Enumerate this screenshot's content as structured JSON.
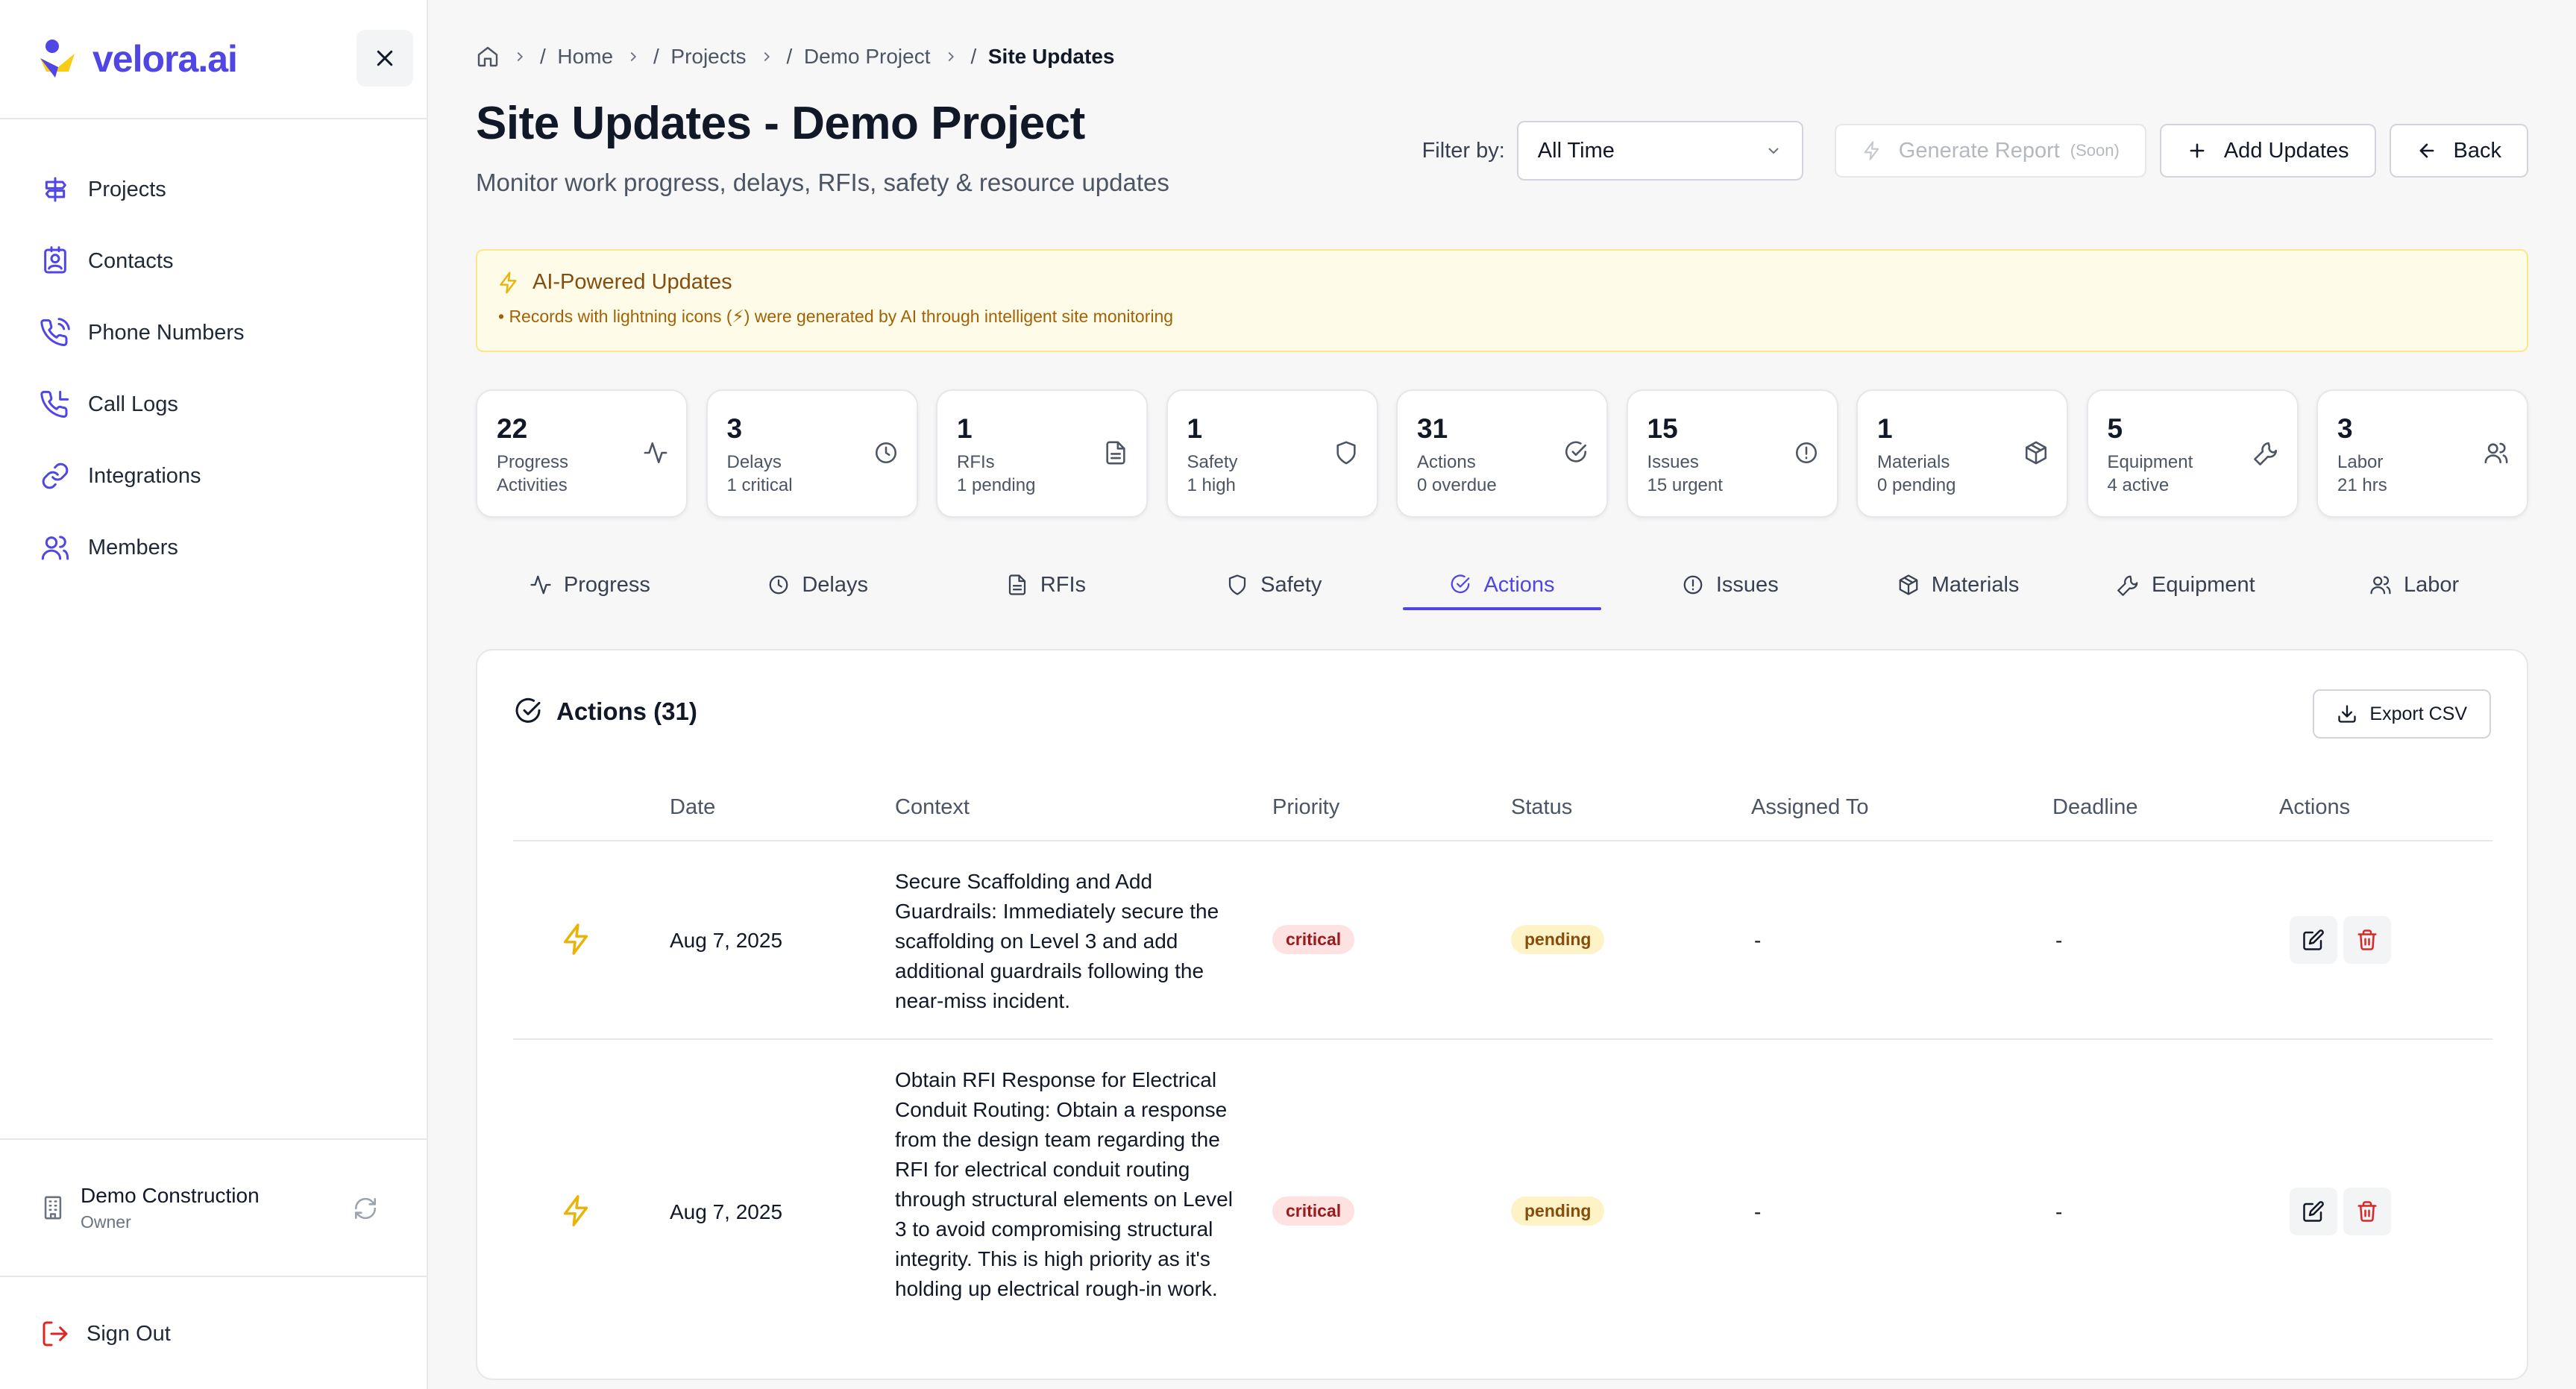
{
  "brand": {
    "name": "velora.ai"
  },
  "sidebar": {
    "items": [
      {
        "label": "Projects",
        "icon": "signpost-icon"
      },
      {
        "label": "Contacts",
        "icon": "contact-card-icon"
      },
      {
        "label": "Phone Numbers",
        "icon": "phone-icon"
      },
      {
        "label": "Call Logs",
        "icon": "phone-call-icon"
      },
      {
        "label": "Integrations",
        "icon": "link-icon"
      },
      {
        "label": "Members",
        "icon": "users-icon"
      }
    ],
    "org": {
      "name": "Demo Construction",
      "role": "Owner"
    },
    "signout": "Sign Out"
  },
  "breadcrumb": [
    "Home",
    "Projects",
    "Demo Project",
    "Site Updates"
  ],
  "page": {
    "title": "Site Updates - Demo Project",
    "subtitle": "Monitor work progress, delays, RFIs, safety & resource updates"
  },
  "toolbar": {
    "filter_label": "Filter by:",
    "filter_value": "All Time",
    "generate_label": "Generate Report",
    "generate_soon": "(Soon)",
    "add_label": "Add Updates",
    "back_label": "Back"
  },
  "ai_banner": {
    "title": "AI-Powered Updates",
    "desc": "• Records with lightning icons (⚡) were generated by AI through intelligent site monitoring"
  },
  "stats": [
    {
      "value": "22",
      "label": "Progress",
      "sub": "Activities",
      "icon": "activity-icon"
    },
    {
      "value": "3",
      "label": "Delays",
      "sub": "1 critical",
      "icon": "clock-icon"
    },
    {
      "value": "1",
      "label": "RFIs",
      "sub": "1 pending",
      "icon": "document-icon"
    },
    {
      "value": "1",
      "label": "Safety",
      "sub": "1 high",
      "icon": "shield-icon"
    },
    {
      "value": "31",
      "label": "Actions",
      "sub": "0 overdue",
      "icon": "check-circle-icon"
    },
    {
      "value": "15",
      "label": "Issues",
      "sub": "15 urgent",
      "icon": "alert-circle-icon"
    },
    {
      "value": "1",
      "label": "Materials",
      "sub": "0 pending",
      "icon": "package-icon"
    },
    {
      "value": "5",
      "label": "Equipment",
      "sub": "4 active",
      "icon": "wrench-icon"
    },
    {
      "value": "3",
      "label": "Labor",
      "sub": "21 hrs",
      "icon": "users-icon"
    }
  ],
  "tabs": [
    {
      "label": "Progress",
      "active": false
    },
    {
      "label": "Delays",
      "active": false
    },
    {
      "label": "RFIs",
      "active": false
    },
    {
      "label": "Safety",
      "active": false
    },
    {
      "label": "Actions",
      "active": true
    },
    {
      "label": "Issues",
      "active": false
    },
    {
      "label": "Materials",
      "active": false
    },
    {
      "label": "Equipment",
      "active": false
    },
    {
      "label": "Labor",
      "active": false
    }
  ],
  "actions_card": {
    "title": "Actions (31)",
    "export_label": "Export CSV",
    "columns": [
      "Date",
      "Context",
      "Priority",
      "Status",
      "Assigned To",
      "Deadline",
      "Actions"
    ],
    "rows": [
      {
        "date": "Aug 7, 2025",
        "context": "Secure Scaffolding and Add Guardrails: Immediately secure the scaffolding on Level 3 and add additional guardrails following the near-miss incident.",
        "priority": "critical",
        "status": "pending",
        "assigned": "-",
        "deadline": "-"
      },
      {
        "date": "Aug 7, 2025",
        "context": "Obtain RFI Response for Electrical Conduit Routing: Obtain a response from the design team regarding the RFI for electrical conduit routing through structural elements on Level 3 to avoid compromising structural integrity. This is high priority as it's holding up electrical rough-in work.",
        "priority": "critical",
        "status": "pending",
        "assigned": "-",
        "deadline": "-"
      }
    ]
  },
  "colors": {
    "accent": "#4f46e5",
    "ai_bolt": "#eab308",
    "critical_bg": "#fee2e2",
    "pending_bg": "#fef3c7",
    "delete": "#dc2626"
  }
}
